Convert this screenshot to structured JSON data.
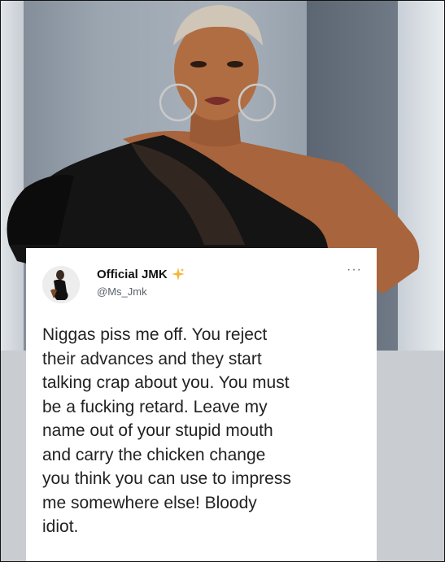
{
  "tweet": {
    "display_name": "Official JMK",
    "handle": "@Ms_Jmk",
    "more_icon": "more-options-icon",
    "verified_icon": "sparkle-icon",
    "text_lines": [
      "Niggas piss me off. You reject",
      "their advances and they start",
      "talking crap about you. You must",
      "be a fucking retard. Leave my",
      "name out of your stupid mouth",
      "and carry the chicken change",
      "you think you can use to impress",
      "me somewhere else! Bloody",
      "idiot."
    ]
  },
  "colors": {
    "card_bg": "#ffffff",
    "text": "#222222",
    "handle": "#59636b",
    "sparkle": "#f5b53a"
  }
}
